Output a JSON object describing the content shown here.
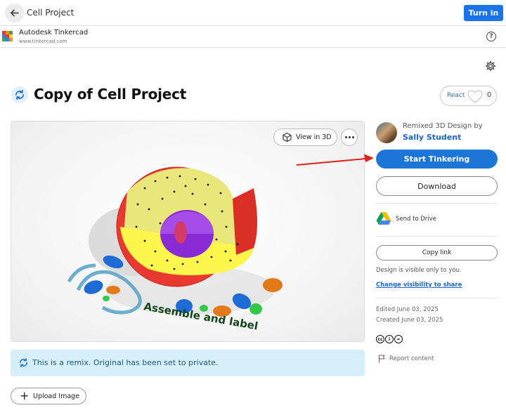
{
  "topbar": {
    "title": "Cell Project",
    "turn_in_label": "Turn in",
    "accent": "#1a73e8"
  },
  "appbar": {
    "name": "Autodesk Tinkercad",
    "url": "www.tinkercad.com",
    "help_icon": "question-circle-icon",
    "help_glyph": "?"
  },
  "page": {
    "title": "Copy of Cell Project",
    "title_icon": "remix-icon"
  },
  "react": {
    "label": "React",
    "count": "0"
  },
  "preview": {
    "view_3d_label": "View in 3D",
    "more_icon": "more-horizontal-icon",
    "model_text": "Assemble and label"
  },
  "remix_notice": {
    "text": "This is a remix. Original has been set to private.",
    "background": "#d5eefa"
  },
  "upload": {
    "label": "Upload Image",
    "plus_glyph": "+"
  },
  "sidebar": {
    "remixed_label": "Remixed 3D Design by",
    "author": "Sally Student",
    "start_label": "Start Tinkering",
    "download_label": "Download",
    "drive_label": "Send to Drive",
    "copy_link_label": "Copy link",
    "visibility_note": "Design is visible only to you.",
    "visibility_link": "Change visibility to share",
    "edited": "Edited June 03, 2025",
    "created": "Created June 03, 2025",
    "license_icons": [
      "cc",
      "i",
      "="
    ],
    "report_label": "Report content",
    "primary_color": "#1b76d8"
  }
}
